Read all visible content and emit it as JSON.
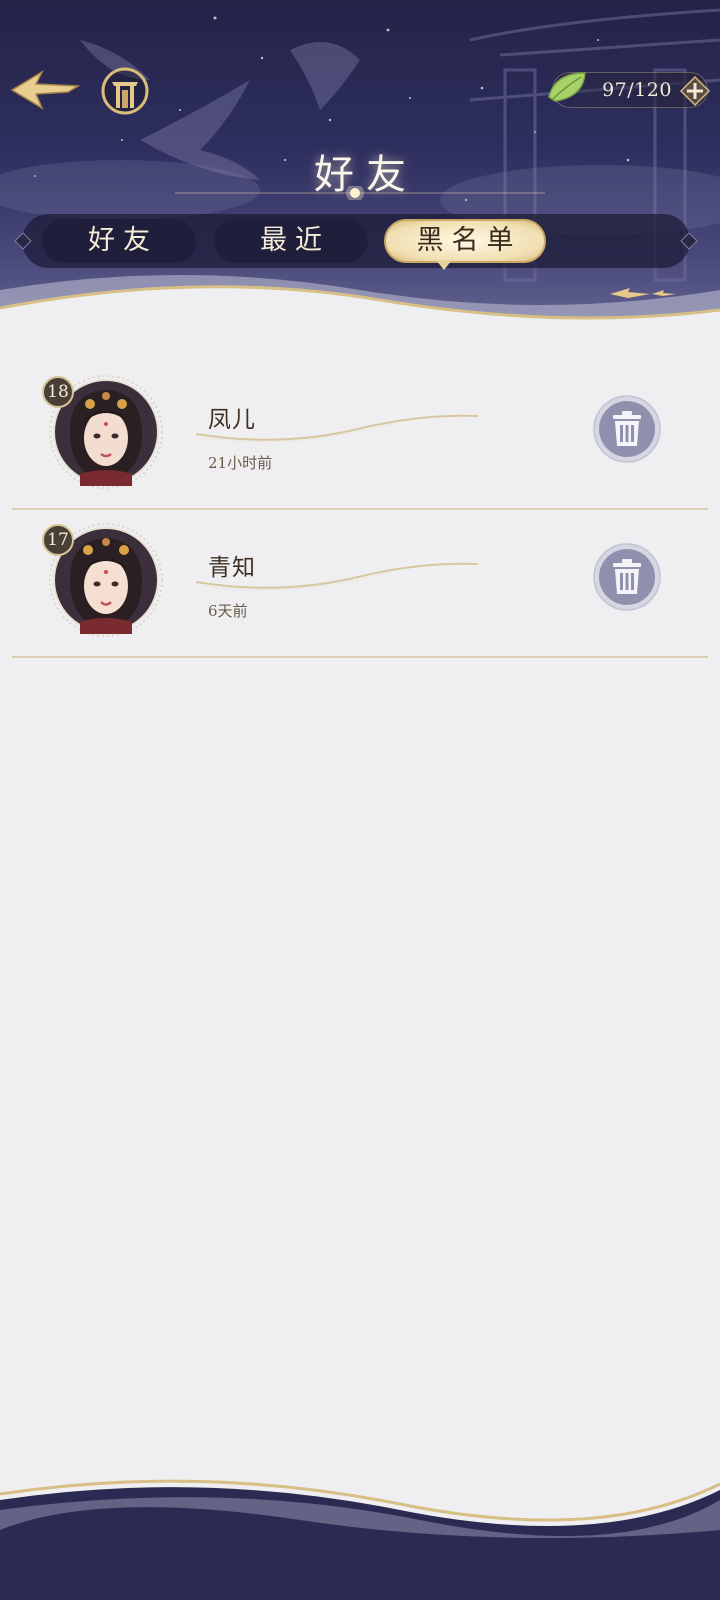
{
  "header": {
    "title": "好友",
    "stamina": {
      "current": "97",
      "max": "120",
      "display": "97/120"
    }
  },
  "tabs": [
    {
      "label": "好友",
      "selected": false
    },
    {
      "label": "最近",
      "selected": false
    },
    {
      "label": "黑名单",
      "selected": true
    }
  ],
  "blacklist": [
    {
      "name": "凤儿",
      "level": "18",
      "last_seen": "21小时前"
    },
    {
      "name": "青知",
      "level": "17",
      "last_seen": "6天前"
    }
  ],
  "icons": {
    "back": "back-arrow-icon",
    "home": "pavilion-home-icon",
    "stamina": "leaf-icon",
    "add": "plus-icon",
    "delete": "trash-icon"
  },
  "colors": {
    "header_dark": "#232348",
    "header_light": "#6a6a96",
    "gold_accent": "#c9a765",
    "page_bg": "#efeff2",
    "name_text": "#3f3024"
  }
}
